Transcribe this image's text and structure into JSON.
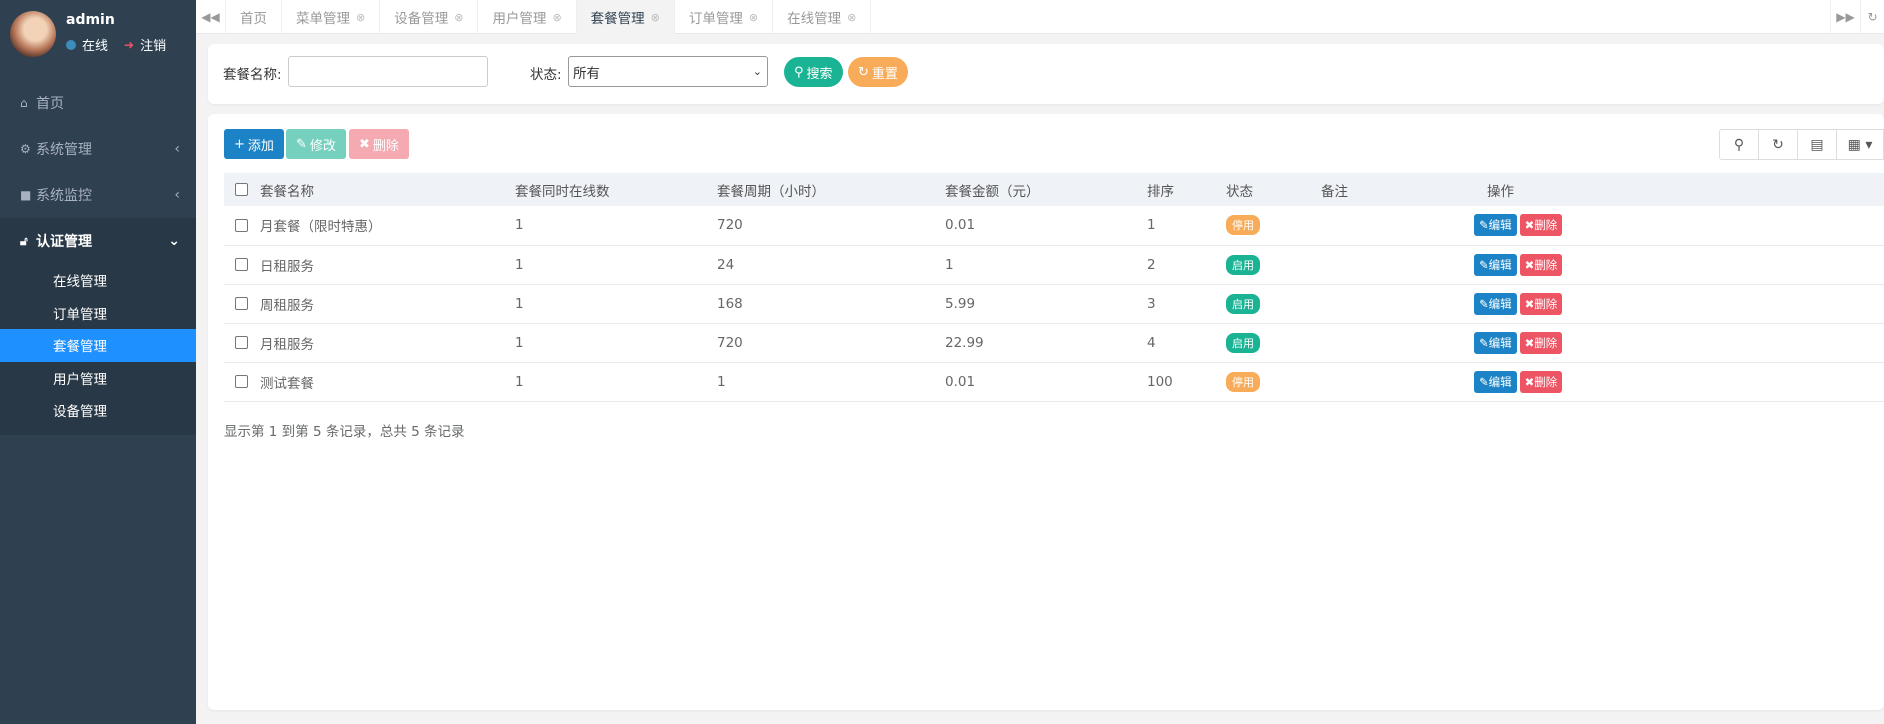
{
  "user": {
    "name": "admin",
    "status": "在线",
    "logout": "注销"
  },
  "nav": {
    "home": "首页",
    "system": "系统管理",
    "monitor": "系统监控",
    "auth": "认证管理",
    "sub": [
      "在线管理",
      "订单管理",
      "套餐管理",
      "用户管理",
      "设备管理"
    ]
  },
  "tabs": [
    "首页",
    "菜单管理",
    "设备管理",
    "用户管理",
    "套餐管理",
    "订单管理",
    "在线管理"
  ],
  "search": {
    "name_label": "套餐名称:",
    "name_value": "",
    "status_label": "状态:",
    "status_value": "所有",
    "search_btn": "搜索",
    "reset_btn": "重置"
  },
  "toolbar": {
    "add": "添加",
    "edit": "修改",
    "delete": "删除"
  },
  "table": {
    "headers": [
      "套餐名称",
      "套餐同时在线数",
      "套餐周期（小时）",
      "套餐金额（元）",
      "排序",
      "状态",
      "备注",
      "操作"
    ],
    "rows": [
      {
        "name": "月套餐（限时特惠）",
        "online": "1",
        "period": "720",
        "price": "0.01",
        "sort": "1",
        "status": "停用",
        "note": ""
      },
      {
        "name": "日租服务",
        "online": "1",
        "period": "24",
        "price": "1",
        "sort": "2",
        "status": "启用",
        "note": ""
      },
      {
        "name": "周租服务",
        "online": "1",
        "period": "168",
        "price": "5.99",
        "sort": "3",
        "status": "启用",
        "note": ""
      },
      {
        "name": "月租服务",
        "online": "1",
        "period": "720",
        "price": "22.99",
        "sort": "4",
        "status": "启用",
        "note": ""
      },
      {
        "name": "测试套餐",
        "online": "1",
        "period": "1",
        "price": "0.01",
        "sort": "100",
        "status": "停用",
        "note": ""
      }
    ],
    "edit_label": "编辑",
    "delete_label": "删除"
  },
  "pagination": "显示第 1 到第 5 条记录，总共 5 条记录",
  "colors": {
    "sidebar": "#2f4050",
    "active": "#1e90ff",
    "primary": "#1c84c6",
    "success": "#1ab394",
    "warning": "#f8ac59",
    "danger": "#ed5565"
  }
}
